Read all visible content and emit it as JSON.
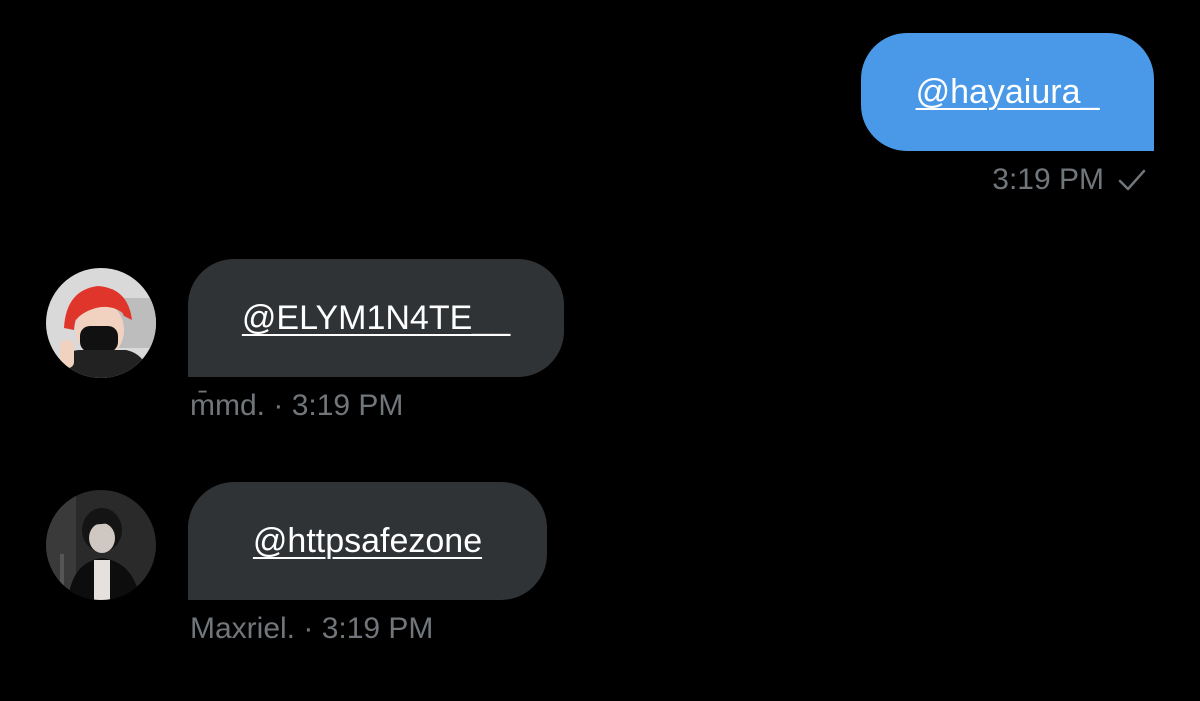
{
  "messages": {
    "outgoing": {
      "text": "@hayaiura_",
      "time": "3:19 PM",
      "status_icon": "check-icon"
    },
    "incoming": [
      {
        "text": "@ELYM1N4TE__",
        "sender": "m̄md.",
        "separator": "·",
        "time": "3:19 PM",
        "avatar": "red-hair-masked-person-avatar"
      },
      {
        "text": "@httpsafezone",
        "sender": "Maxriel.",
        "separator": "·",
        "time": "3:19 PM",
        "avatar": "dark-haired-person-avatar"
      }
    ]
  },
  "colors": {
    "background": "#000000",
    "outgoing_bubble": "#4a99e9",
    "incoming_bubble": "#2f3336",
    "meta_text": "#71767b",
    "message_text": "#ffffff"
  }
}
